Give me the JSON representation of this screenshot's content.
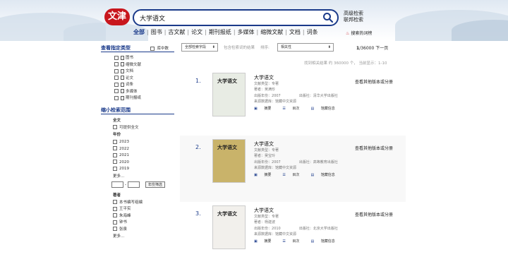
{
  "header": {
    "logo_text": "文津",
    "search_value": "大学语文",
    "advanced_search": "高级检索",
    "federated_search": "联邦检索",
    "hot_words": "搜索热词榜",
    "nav": [
      {
        "label": "全部",
        "active": true
      },
      {
        "label": "图书",
        "active": false
      },
      {
        "label": "古文献",
        "active": false
      },
      {
        "label": "论文",
        "active": false
      },
      {
        "label": "期刊报纸",
        "active": false
      },
      {
        "label": "多媒体",
        "active": false
      },
      {
        "label": "缩微文献",
        "active": false
      },
      {
        "label": "文档",
        "active": false
      },
      {
        "label": "词条",
        "active": false
      }
    ]
  },
  "toolbar": {
    "field_select": "全部检索字段",
    "within_results": "包含检索词的结果",
    "sort_label": "排序:",
    "sort_select": "相关性",
    "page": "1",
    "total_pages": "/36000",
    "next": "下一页",
    "count_text": "找到相关结果 约 360000 个， 当前显示：1-10"
  },
  "sidebar": {
    "type_title": "查看指定类型",
    "in_library": "库中数",
    "types": [
      "图书",
      "缩微文献",
      "文档",
      "论文",
      "词条",
      "多媒体",
      "期刊报纸"
    ],
    "range_title": "缩小检索范围",
    "all_text_label": "全文",
    "all_text_option": "可提供全文",
    "year_label": "年份",
    "years": [
      "2023",
      "2022",
      "2021",
      "2020",
      "2019"
    ],
    "more": "更多...",
    "year_filter_button": "年份筛选",
    "author_label": "著者",
    "authors": [
      "本书编写组编",
      "王平实",
      "朱海峰",
      "钟书",
      "张泉"
    ]
  },
  "results": [
    {
      "num": "1.",
      "title": "大学语文",
      "type_label": "文献类型：",
      "type_value": "专著",
      "author_label": "著者：",
      "author_value": "吴满珍",
      "year_label": "出版年份：",
      "year_value": "2007",
      "pub_label": "出版社：",
      "pub_value": "清华大学出版社",
      "src_label": "来源数据库：",
      "src_value": "馆藏中文资源",
      "links": [
        "摘要",
        "目次",
        "馆藏信息"
      ],
      "other": "查看其他版本或分册",
      "cover_title": "大学语文",
      "cover_bg": "#e8ece4"
    },
    {
      "num": "2.",
      "title": "大学语文",
      "type_label": "文献类型：",
      "type_value": "专著",
      "author_label": "著者：",
      "author_value": "吴宝玲",
      "year_label": "出版年份：",
      "year_value": "2007",
      "pub_label": "出版社：",
      "pub_value": "高等教育出版社",
      "src_label": "来源数据库：",
      "src_value": "馆藏中文资源",
      "links": [
        "摘要",
        "目次",
        "馆藏信息"
      ],
      "other": "查看其他版本或分册",
      "cover_title": "大学语文",
      "cover_bg": "#c9b36a"
    },
    {
      "num": "3.",
      "title": "大学语文",
      "type_label": "文献类型：",
      "type_value": "专著",
      "author_label": "著者：",
      "author_value": "杨建波",
      "year_label": "出版年份：",
      "year_value": "2010",
      "pub_label": "出版社：",
      "pub_value": "北京大学出版社",
      "src_label": "来源数据库：",
      "src_value": "馆藏中文资源",
      "links": [
        "摘要",
        "目次",
        "馆藏信息"
      ],
      "other": "查看其他版本或分册",
      "cover_title": "大学语文",
      "cover_bg": "#f2f0ec"
    }
  ],
  "colors": {
    "brand_red": "#c8161d",
    "brand_blue": "#1a3a8a"
  }
}
